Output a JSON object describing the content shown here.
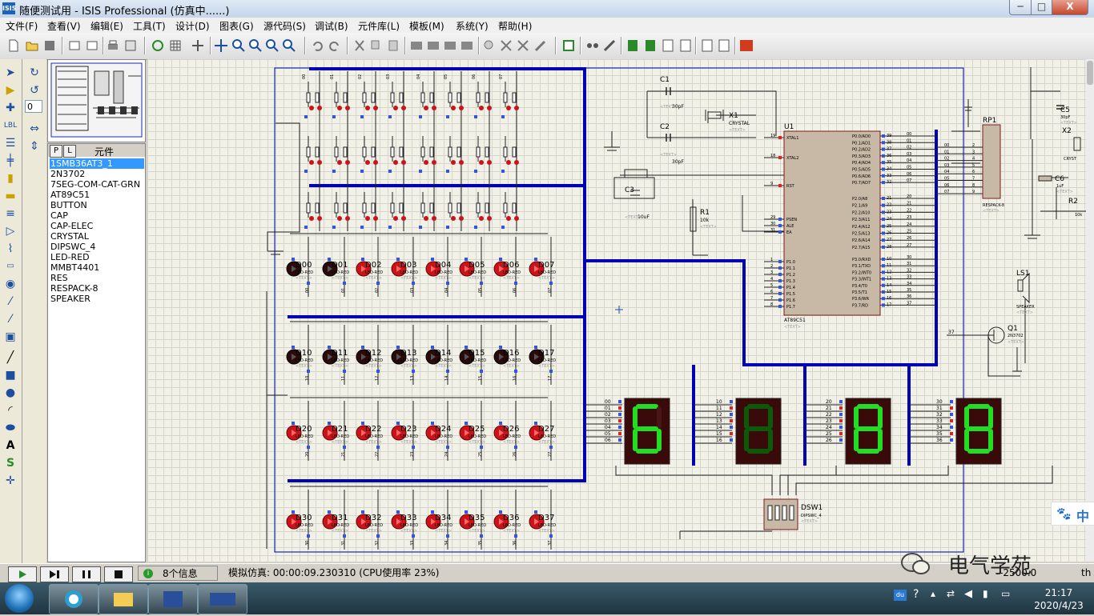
{
  "window": {
    "app_icon": "ISIS",
    "title": "随便测试用 - ISIS Professional (仿真中......)",
    "min_symbol": "─",
    "max_symbol": "□",
    "close_symbol": "X"
  },
  "menu": [
    "文件(F)",
    "查看(V)",
    "编辑(E)",
    "工具(T)",
    "设计(D)",
    "图表(G)",
    "源代码(S)",
    "调试(B)",
    "元件库(L)",
    "模板(M)",
    "系统(Y)",
    "帮助(H)"
  ],
  "left_panel": {
    "angle_value": "0",
    "parts_tabs": [
      "P",
      "L"
    ],
    "parts_title": "元件",
    "parts": [
      "1SMB36AT3_1",
      "2N3702",
      "7SEG-COM-CAT-GRN",
      "AT89C51",
      "BUTTON",
      "CAP",
      "CAP-ELEC",
      "CRYSTAL",
      "DIPSWC_4",
      "LED-RED",
      "MMBT4401",
      "RES",
      "RESPACK-8",
      "SPEAKER"
    ],
    "selected_part": 0
  },
  "schematic": {
    "components": {
      "c1": {
        "ref": "C1",
        "value": "30pF",
        "text": "<TEXT>"
      },
      "c2": {
        "ref": "C2",
        "value": "30pF",
        "text": "<TEXT>"
      },
      "c3": {
        "ref": "C3",
        "value": "10uF",
        "text": "<TEXT>"
      },
      "x1": {
        "ref": "X1",
        "value": "CRYSTAL",
        "text": "<TEXT>"
      },
      "r1": {
        "ref": "R1",
        "value": "10k",
        "text": "<TEXT>"
      },
      "u1": {
        "ref": "U1",
        "value": "AT89C51",
        "text": "<TEXT>"
      },
      "rp1": {
        "ref": "RP1",
        "value": "RESPACK-8",
        "text": "<TEXT>"
      },
      "ls1": {
        "ref": "LS1",
        "value": "SPEAKER",
        "text": "<TEXT>"
      },
      "q1": {
        "ref": "Q1",
        "value": "2N3702",
        "text": "<TEXT>"
      },
      "dsw1": {
        "ref": "DSW1",
        "value": "DIPSWC_4",
        "text": "<TEXT>"
      },
      "c5": {
        "ref": "C5",
        "value": "30pF",
        "text": "<TEXT>"
      },
      "x2": {
        "ref": "X2",
        "value": "CRYST"
      },
      "c6": {
        "ref": "C6",
        "value": "1uF",
        "text": "<TEXT>"
      },
      "r2": {
        "ref": "R2",
        "value": "10k"
      }
    },
    "u1_left_pins": [
      {
        "num": "19",
        "name": "XTAL1"
      },
      {
        "num": "18",
        "name": "XTAL2"
      },
      {
        "num": "9",
        "name": "RST"
      },
      {
        "num": "29",
        "name": "PSEN"
      },
      {
        "num": "30",
        "name": "ALE"
      },
      {
        "num": "31",
        "name": "EA"
      },
      {
        "num": "1",
        "name": "P1.0"
      },
      {
        "num": "2",
        "name": "P1.1"
      },
      {
        "num": "3",
        "name": "P1.2"
      },
      {
        "num": "4",
        "name": "P1.3"
      },
      {
        "num": "5",
        "name": "P1.4"
      },
      {
        "num": "6",
        "name": "P1.5"
      },
      {
        "num": "7",
        "name": "P1.6"
      },
      {
        "num": "8",
        "name": "P1.7"
      }
    ],
    "u1_right_pins": [
      {
        "num": "39",
        "name": "P0.0/AD0",
        "net": "00"
      },
      {
        "num": "38",
        "name": "P0.1/AD1",
        "net": "01"
      },
      {
        "num": "37",
        "name": "P0.2/AD2",
        "net": "02"
      },
      {
        "num": "36",
        "name": "P0.3/AD3",
        "net": "03"
      },
      {
        "num": "35",
        "name": "P0.4/AD4",
        "net": "04"
      },
      {
        "num": "34",
        "name": "P0.5/AD5",
        "net": "05"
      },
      {
        "num": "33",
        "name": "P0.6/AD6",
        "net": "06"
      },
      {
        "num": "32",
        "name": "P0.7/AD7",
        "net": "07"
      },
      {
        "num": "21",
        "name": "P2.0/A8",
        "net": "20"
      },
      {
        "num": "22",
        "name": "P2.1/A9",
        "net": "21"
      },
      {
        "num": "23",
        "name": "P2.2/A10",
        "net": "22"
      },
      {
        "num": "24",
        "name": "P2.3/A11",
        "net": "23"
      },
      {
        "num": "25",
        "name": "P2.4/A12",
        "net": "24"
      },
      {
        "num": "26",
        "name": "P2.5/A13",
        "net": "25"
      },
      {
        "num": "27",
        "name": "P2.6/A14",
        "net": "26"
      },
      {
        "num": "28",
        "name": "P2.7/A15",
        "net": "27"
      },
      {
        "num": "10",
        "name": "P3.0/RXD",
        "net": "30"
      },
      {
        "num": "11",
        "name": "P3.1/TXD",
        "net": "31"
      },
      {
        "num": "12",
        "name": "P3.2/INT0",
        "net": "32"
      },
      {
        "num": "13",
        "name": "P3.3/INT1",
        "net": "33"
      },
      {
        "num": "14",
        "name": "P3.4/T0",
        "net": "34"
      },
      {
        "num": "15",
        "name": "P3.5/T1",
        "net": "35"
      },
      {
        "num": "16",
        "name": "P3.6/WR",
        "net": "36"
      },
      {
        "num": "17",
        "name": "P3.7/RD",
        "net": "37"
      }
    ],
    "led_rows": [
      {
        "labels": [
          "D00",
          "D01",
          "D02",
          "D03",
          "D04",
          "D05",
          "D06",
          "D07"
        ],
        "lit": [
          false,
          false,
          true,
          true,
          true,
          true,
          true,
          true
        ]
      },
      {
        "labels": [
          "D10",
          "D11",
          "D12",
          "D13",
          "D14",
          "D15",
          "D16",
          "D17"
        ],
        "lit": [
          false,
          false,
          false,
          false,
          false,
          false,
          false,
          false
        ]
      },
      {
        "labels": [
          "D20",
          "D21",
          "D22",
          "D23",
          "D24",
          "D25",
          "D26",
          "D27"
        ],
        "lit": [
          true,
          true,
          true,
          true,
          true,
          true,
          true,
          true
        ]
      },
      {
        "labels": [
          "D30",
          "D31",
          "D32",
          "D33",
          "D34",
          "D35",
          "D36",
          "D37"
        ],
        "lit": [
          true,
          true,
          true,
          true,
          true,
          true,
          true,
          true
        ]
      }
    ],
    "led_value": "LED-RED",
    "button_col_labels": [
      "00",
      "01",
      "02",
      "03",
      "04",
      "05",
      "06",
      "07"
    ],
    "seven_seg_displays": [
      {
        "pins": [
          "00",
          "01",
          "02",
          "03",
          "04",
          "05",
          "06"
        ],
        "digit": "6",
        "bright": true
      },
      {
        "pins": [
          "10",
          "11",
          "12",
          "13",
          "14",
          "15",
          "16"
        ],
        "digit": "8",
        "bright": false
      },
      {
        "pins": [
          "20",
          "21",
          "22",
          "23",
          "24",
          "25",
          "26"
        ],
        "digit": "8",
        "bright": true
      },
      {
        "pins": [
          "30",
          "31",
          "32",
          "33",
          "34",
          "35",
          "36"
        ],
        "digit": "8",
        "bright": true
      }
    ],
    "net_37": "37"
  },
  "statusbar": {
    "messages": "8个信息",
    "sim_status": "模拟仿真: 00:00:09.230310 (CPU使用率 23%)",
    "coords": "-2500.0",
    "unit_hint": "th"
  },
  "ime": {
    "label": "中"
  },
  "watermark": {
    "text": "电气学苑"
  },
  "taskbar": {
    "time": "21:17",
    "date": "2020/4/23",
    "tray_du": "du"
  },
  "colors": {
    "wire": "#0000b4",
    "led_on": "#c8141a",
    "seg_on": "#22dd22",
    "seg_dim": "#0a5a0a",
    "canvas_bg": "#f2f1e8"
  }
}
